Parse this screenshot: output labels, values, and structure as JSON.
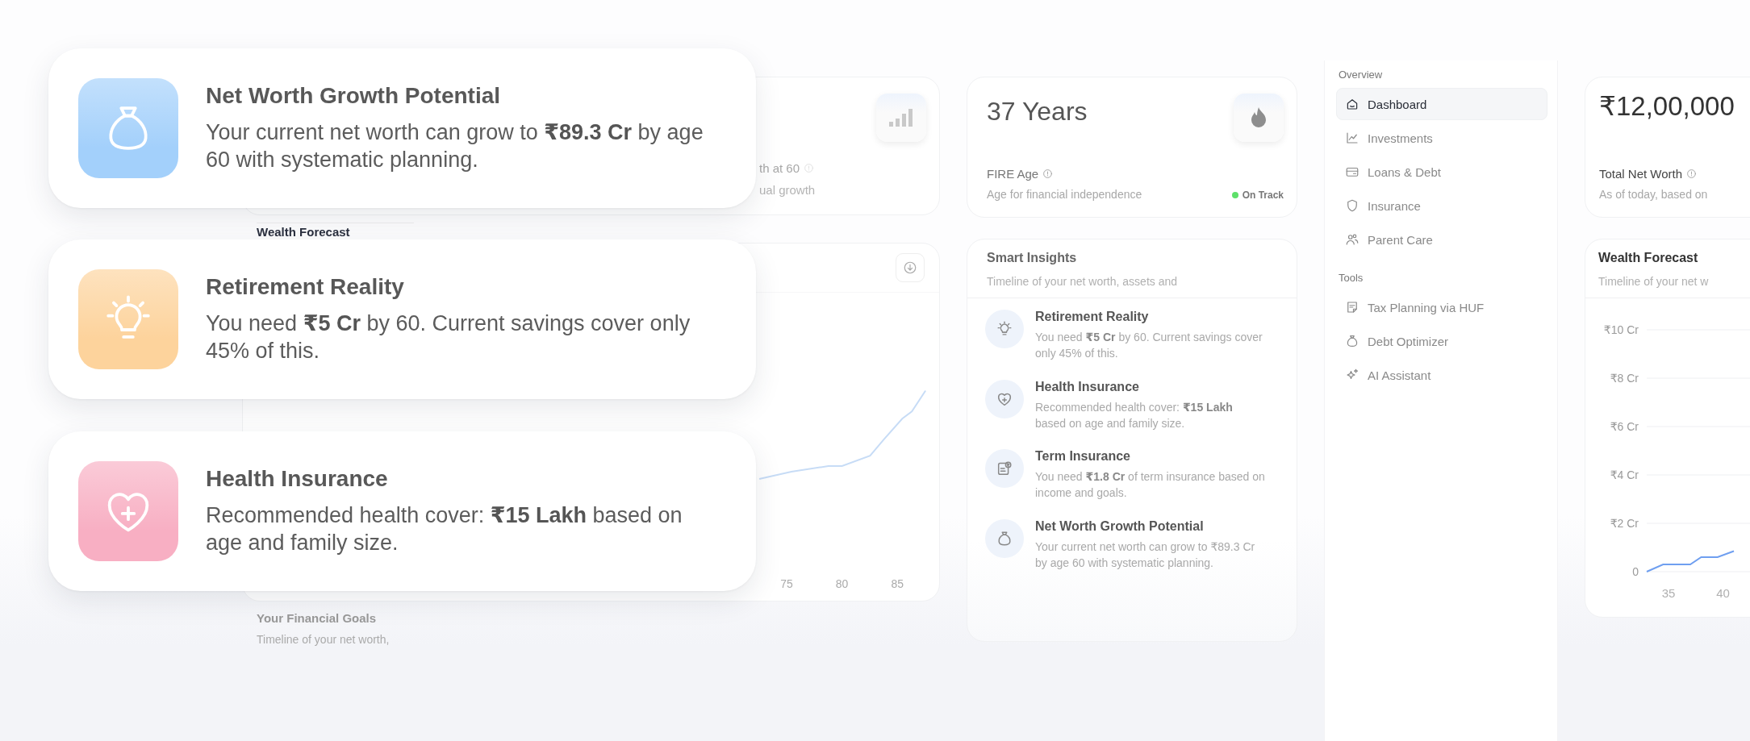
{
  "highlight_cards": [
    {
      "title": "Net Worth Growth Potential",
      "text": "Your current net worth can grow to **₹89.3 Cr** by age 60 with systematic planning.",
      "color": "#a3d0fb"
    },
    {
      "title": "Retirement Reality",
      "text": "You need **₹5 Cr** by 60. Current savings cover only 45% of this.",
      "color": "#fdd39c"
    },
    {
      "title": "Health Insurance",
      "text": "Recommended health cover: **₹15 Lakh** based on age and family size.",
      "color": "#f8afc3"
    }
  ],
  "growth_card": {
    "label": "th at 60",
    "subtitle": "ual growth"
  },
  "forecast_panel": {
    "title": "Wealth Forecast",
    "x_labels": [
      "75",
      "80",
      "85"
    ]
  },
  "goals": {
    "title": "Your Financial Goals",
    "subtitle": "Timeline of your net worth,"
  },
  "fire_card": {
    "value": "37 Years",
    "label": "FIRE Age",
    "subtitle": "Age for financial independence",
    "status": "On Track"
  },
  "smart_insights": {
    "title": "Smart Insights",
    "subtitle": "Timeline of your net worth, assets and",
    "items": [
      {
        "title": "Retirement Reality",
        "text": "You need **₹5 Cr** by 60. Current savings cover only 45% of this."
      },
      {
        "title": "Health Insurance",
        "text": "Recommended health cover: **₹15 Lakh** based on age and family size."
      },
      {
        "title": "Term Insurance",
        "text": "You need **₹1.8 Cr** of term insurance based on income and goals."
      },
      {
        "title": "Net Worth Growth Potential",
        "text": "Your current net worth can grow to ₹89.3 Cr by age 60 with systematic planning."
      }
    ]
  },
  "sidebar": {
    "sections": [
      {
        "heading": "Overview",
        "items": [
          {
            "label": "Dashboard",
            "selected": true
          },
          {
            "label": "Investments",
            "selected": false
          },
          {
            "label": "Loans & Debt",
            "selected": false
          },
          {
            "label": "Insurance",
            "selected": false
          },
          {
            "label": "Parent Care",
            "selected": false
          }
        ]
      },
      {
        "heading": "Tools",
        "items": [
          {
            "label": "Tax Planning via HUF",
            "selected": false
          },
          {
            "label": "Debt Optimizer",
            "selected": false
          },
          {
            "label": "AI Assistant",
            "selected": false
          }
        ]
      }
    ]
  },
  "net_worth_card": {
    "value": "₹12,00,000",
    "label": "Total Net Worth",
    "subtitle": "As of today, based on"
  },
  "wealth_forecast": {
    "title": "Wealth Forecast",
    "subtitle": "Timeline of your net w",
    "chart_data": {
      "type": "line",
      "x": [
        33,
        34.5,
        37,
        38,
        39.5,
        41
      ],
      "series": [
        {
          "color": "#6f9ff0",
          "values": [
            0,
            0.3,
            0.3,
            0.6,
            0.6,
            0.85
          ]
        }
      ],
      "yticks": [
        {
          "value": 0,
          "label": "0"
        },
        {
          "value": 2,
          "label": "₹2 Cr"
        },
        {
          "value": 4,
          "label": "₹4 Cr"
        },
        {
          "value": 6,
          "label": "₹6 Cr"
        },
        {
          "value": 8,
          "label": "₹8 Cr"
        },
        {
          "value": 10,
          "label": "₹10 Cr"
        }
      ],
      "xticks": [
        35,
        40
      ],
      "xlim": [
        33,
        43
      ],
      "ylim": [
        0,
        10
      ],
      "grid": true
    }
  }
}
